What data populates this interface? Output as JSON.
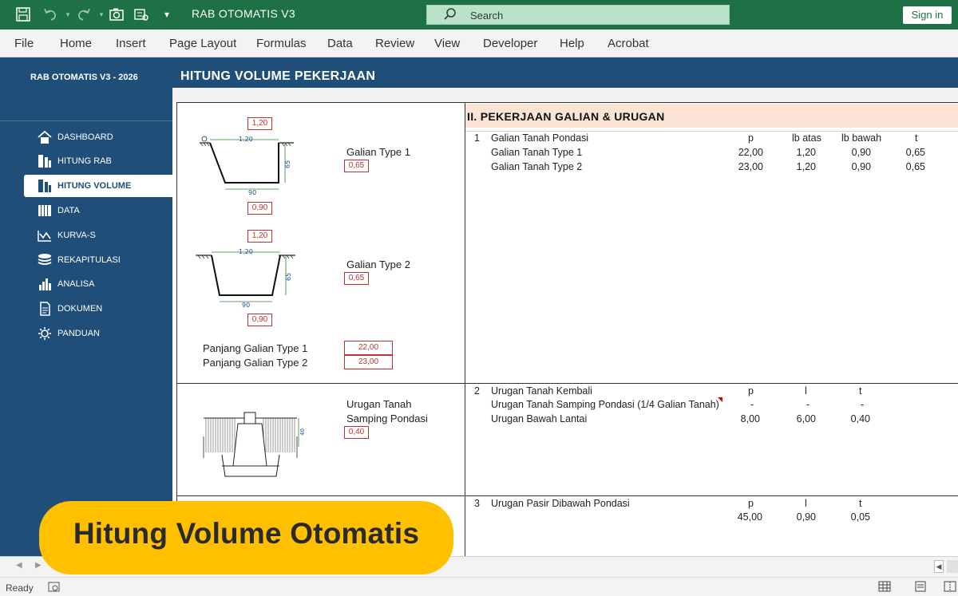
{
  "window": {
    "title": "RAB OTOMATIS V3",
    "search_placeholder": "Search",
    "sign_in": "Sign in"
  },
  "menu": [
    "File",
    "Home",
    "Insert",
    "Page Layout",
    "Formulas",
    "Data",
    "Review",
    "View",
    "Developer",
    "Help",
    "Acrobat"
  ],
  "sidebar": {
    "title": "RAB OTOMATIS V3 - 2026",
    "items": [
      {
        "label": "DASHBOARD",
        "icon": "home-icon"
      },
      {
        "label": "HITUNG RAB",
        "icon": "calculator-icon"
      },
      {
        "label": "HITUNG VOLUME",
        "icon": "volume-icon",
        "active": true
      },
      {
        "label": "DATA",
        "icon": "books-icon"
      },
      {
        "label": "KURVA-S",
        "icon": "curve-icon"
      },
      {
        "label": "REKAPITULASI",
        "icon": "layers-icon"
      },
      {
        "label": "ANALISA",
        "icon": "bar-chart-icon"
      },
      {
        "label": "DOKUMEN",
        "icon": "document-icon"
      },
      {
        "label": "PANDUAN",
        "icon": "gear-icon"
      }
    ]
  },
  "page_title": "HITUNG VOLUME PEKERJAAN",
  "diagrams": {
    "galian1": {
      "top_width": "1,20",
      "depth": "0,65",
      "bottom_width": "0,90",
      "label": "Galian Type 1",
      "dim_top": "1.20",
      "dim_side": "65",
      "dim_bottom": "90"
    },
    "galian2": {
      "top_width": "1,20",
      "depth": "0,65",
      "bottom_width": "0,90",
      "label": "Galian Type 2",
      "dim_top": "1.20",
      "dim_side": "65",
      "dim_bottom": "90"
    },
    "panjang": {
      "label1": "Panjang Galian Type 1",
      "label2": "Panjang Galian Type 2",
      "value1": "22,00",
      "value2": "23,00"
    },
    "urugan": {
      "label_line1": "Urugan Tanah",
      "label_line2": "Samping Pondasi",
      "value": "0,40",
      "dim_side": "40"
    }
  },
  "section": {
    "title": "II. PEKERJAAN GALIAN & URUGAN",
    "groups": [
      {
        "no": "1",
        "name": "Galian Tanah Pondasi",
        "headers": [
          "p",
          "lb atas",
          "lb bawah",
          "t"
        ],
        "rows": [
          {
            "name": "Galian Tanah Type 1",
            "values": [
              "22,00",
              "1,20",
              "0,90",
              "0,65"
            ]
          },
          {
            "name": "Galian Tanah Type 2",
            "values": [
              "23,00",
              "1,20",
              "0,90",
              "0,65"
            ]
          }
        ]
      },
      {
        "no": "2",
        "name": "Urugan Tanah Kembali",
        "headers": [
          "p",
          "l",
          "t"
        ],
        "rows": [
          {
            "name": "Urugan Tanah Samping Pondasi (1/4 Galian Tanah)",
            "values": [
              "-",
              "-",
              "-"
            ]
          },
          {
            "name": "Urugan Bawah Lantai",
            "values": [
              "8,00",
              "6,00",
              "0,40"
            ]
          }
        ]
      },
      {
        "no": "3",
        "name": "Urugan Pasir Dibawah Pondasi",
        "headers": [
          "p",
          "l",
          "t"
        ],
        "rows": [
          {
            "name": "",
            "values": [
              "45,00",
              "0,90",
              "0,05"
            ]
          }
        ]
      }
    ]
  },
  "banner": "Hitung Volume Otomatis",
  "status": {
    "ready": "Ready"
  },
  "colors": {
    "excel_green": "#1e7145",
    "sidebar_blue": "#1f4e79",
    "banner_yellow": "#ffc000",
    "section_fill": "#fbe4d5"
  }
}
